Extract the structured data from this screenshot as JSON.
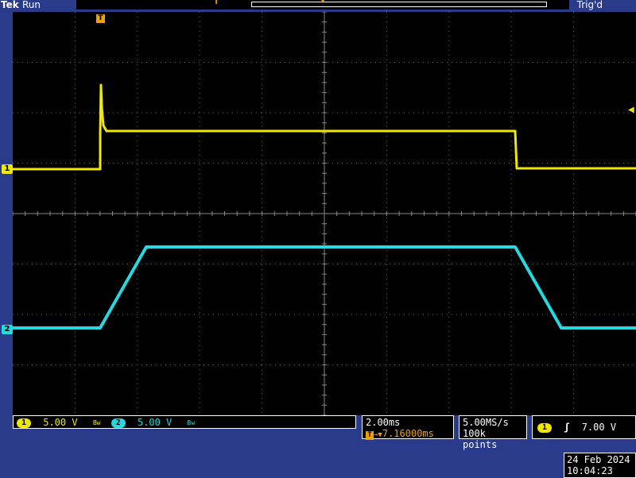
{
  "header": {
    "brand": "Tek",
    "run_state": "Run",
    "trigger_status": "Trig'd"
  },
  "markers": {
    "ch1": "1",
    "ch2": "2",
    "trigger": "T"
  },
  "vertical": {
    "ch1_label": "1",
    "ch1_scale": "5.00 V",
    "ch1_bw": "Bw",
    "ch2_label": "2",
    "ch2_scale": "5.00 V",
    "ch2_bw": "Bw"
  },
  "horizontal": {
    "time_per_div": "2.00ms",
    "trigger_position": "7.16000ms",
    "trigger_icon": "T"
  },
  "acquisition": {
    "sample_rate": "5.00MS/s",
    "record_length": "100k points"
  },
  "trigger": {
    "source": "1",
    "slope_icon": "rising-edge-icon",
    "level": "7.00 V"
  },
  "datetime": {
    "date": "24 Feb  2024",
    "time": "10:04:23"
  },
  "colors": {
    "ch1": "#f0e800",
    "ch2": "#26d8e0",
    "trigger_marker": "#f0a000",
    "background": "#2b3b8c"
  }
}
